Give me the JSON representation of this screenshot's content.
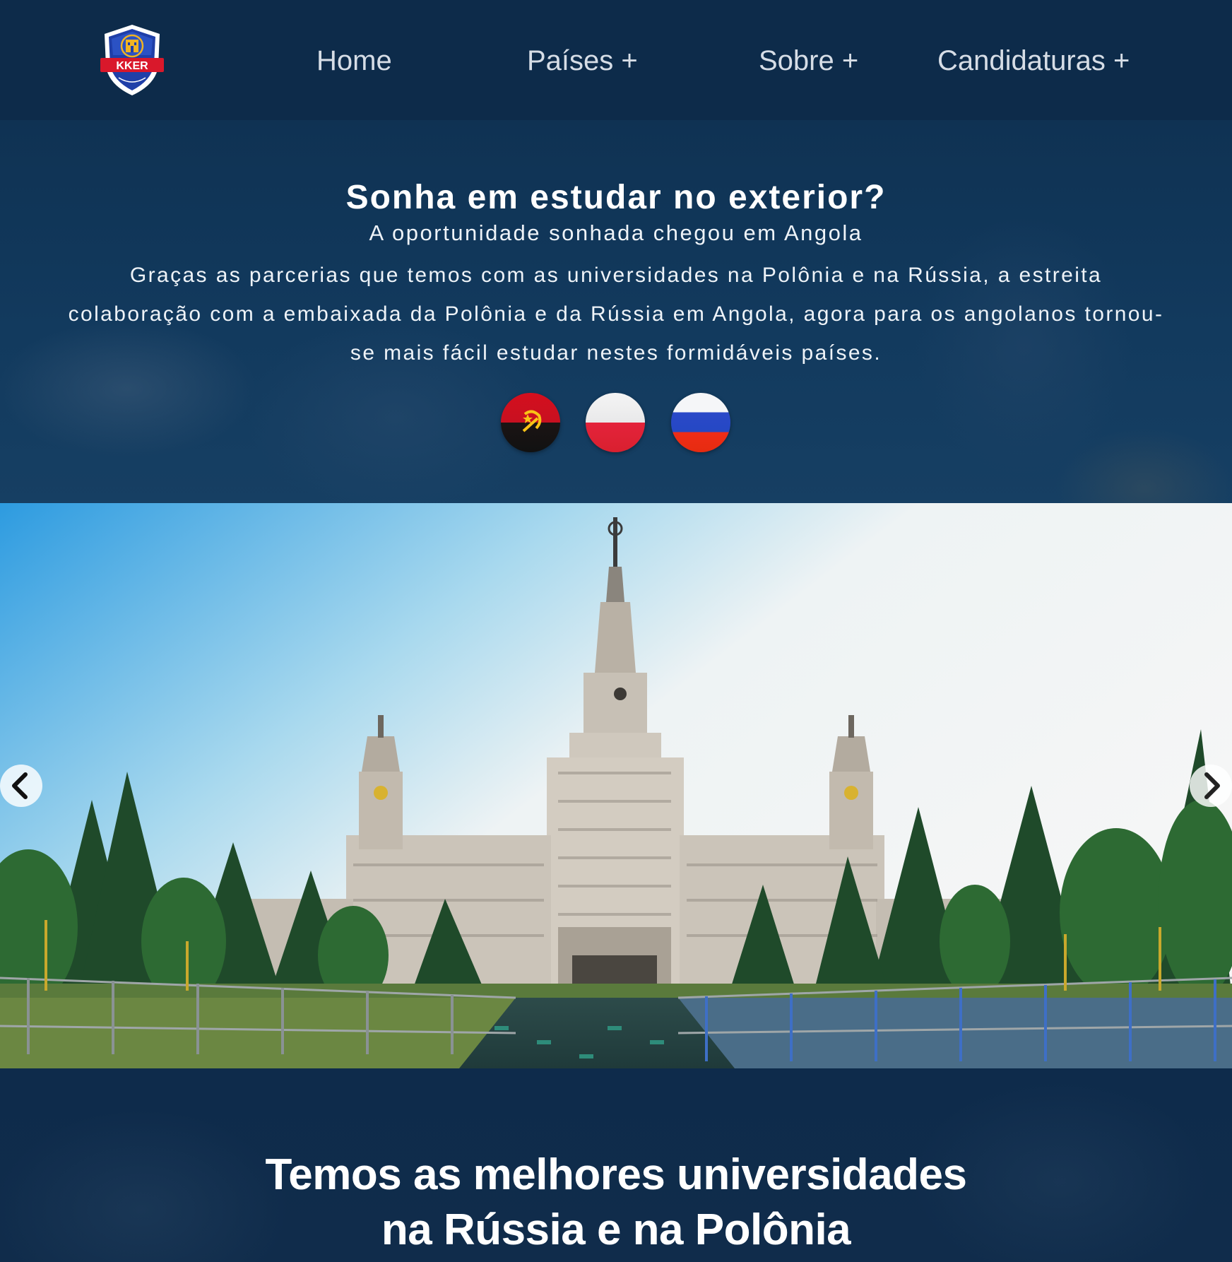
{
  "header": {
    "logo_text": "KKER",
    "nav": [
      {
        "label": "Home"
      },
      {
        "label": "Países +"
      },
      {
        "label": "Sobre +"
      },
      {
        "label": "Candidaturas +"
      }
    ]
  },
  "hero": {
    "title": "Sonha em estudar no exterior?",
    "subtitle": "A oportunidade sonhada chegou em Angola",
    "text": "Graças as parcerias que temos com as universidades na Polônia e na Rússia, a estreita colaboração com a embaixada da Polônia e da Rússia em Angola, agora para os angolanos tornou-se mais fácil estudar nestes formidáveis países.",
    "flags": [
      {
        "name": "angola-flag-icon"
      },
      {
        "name": "poland-flag-icon"
      },
      {
        "name": "russia-flag-icon"
      }
    ]
  },
  "carousel": {
    "prev_icon": "chevron-left-icon",
    "next_icon": "chevron-right-icon"
  },
  "section": {
    "heading_line1": "Temos as melhores universidades",
    "heading_line2": "na Rússia e na Polônia"
  },
  "colors": {
    "header_bg": "#0d2b4a",
    "hero_bg": "#123a5e",
    "nav_text": "#d6dde6",
    "text": "#ffffff"
  }
}
